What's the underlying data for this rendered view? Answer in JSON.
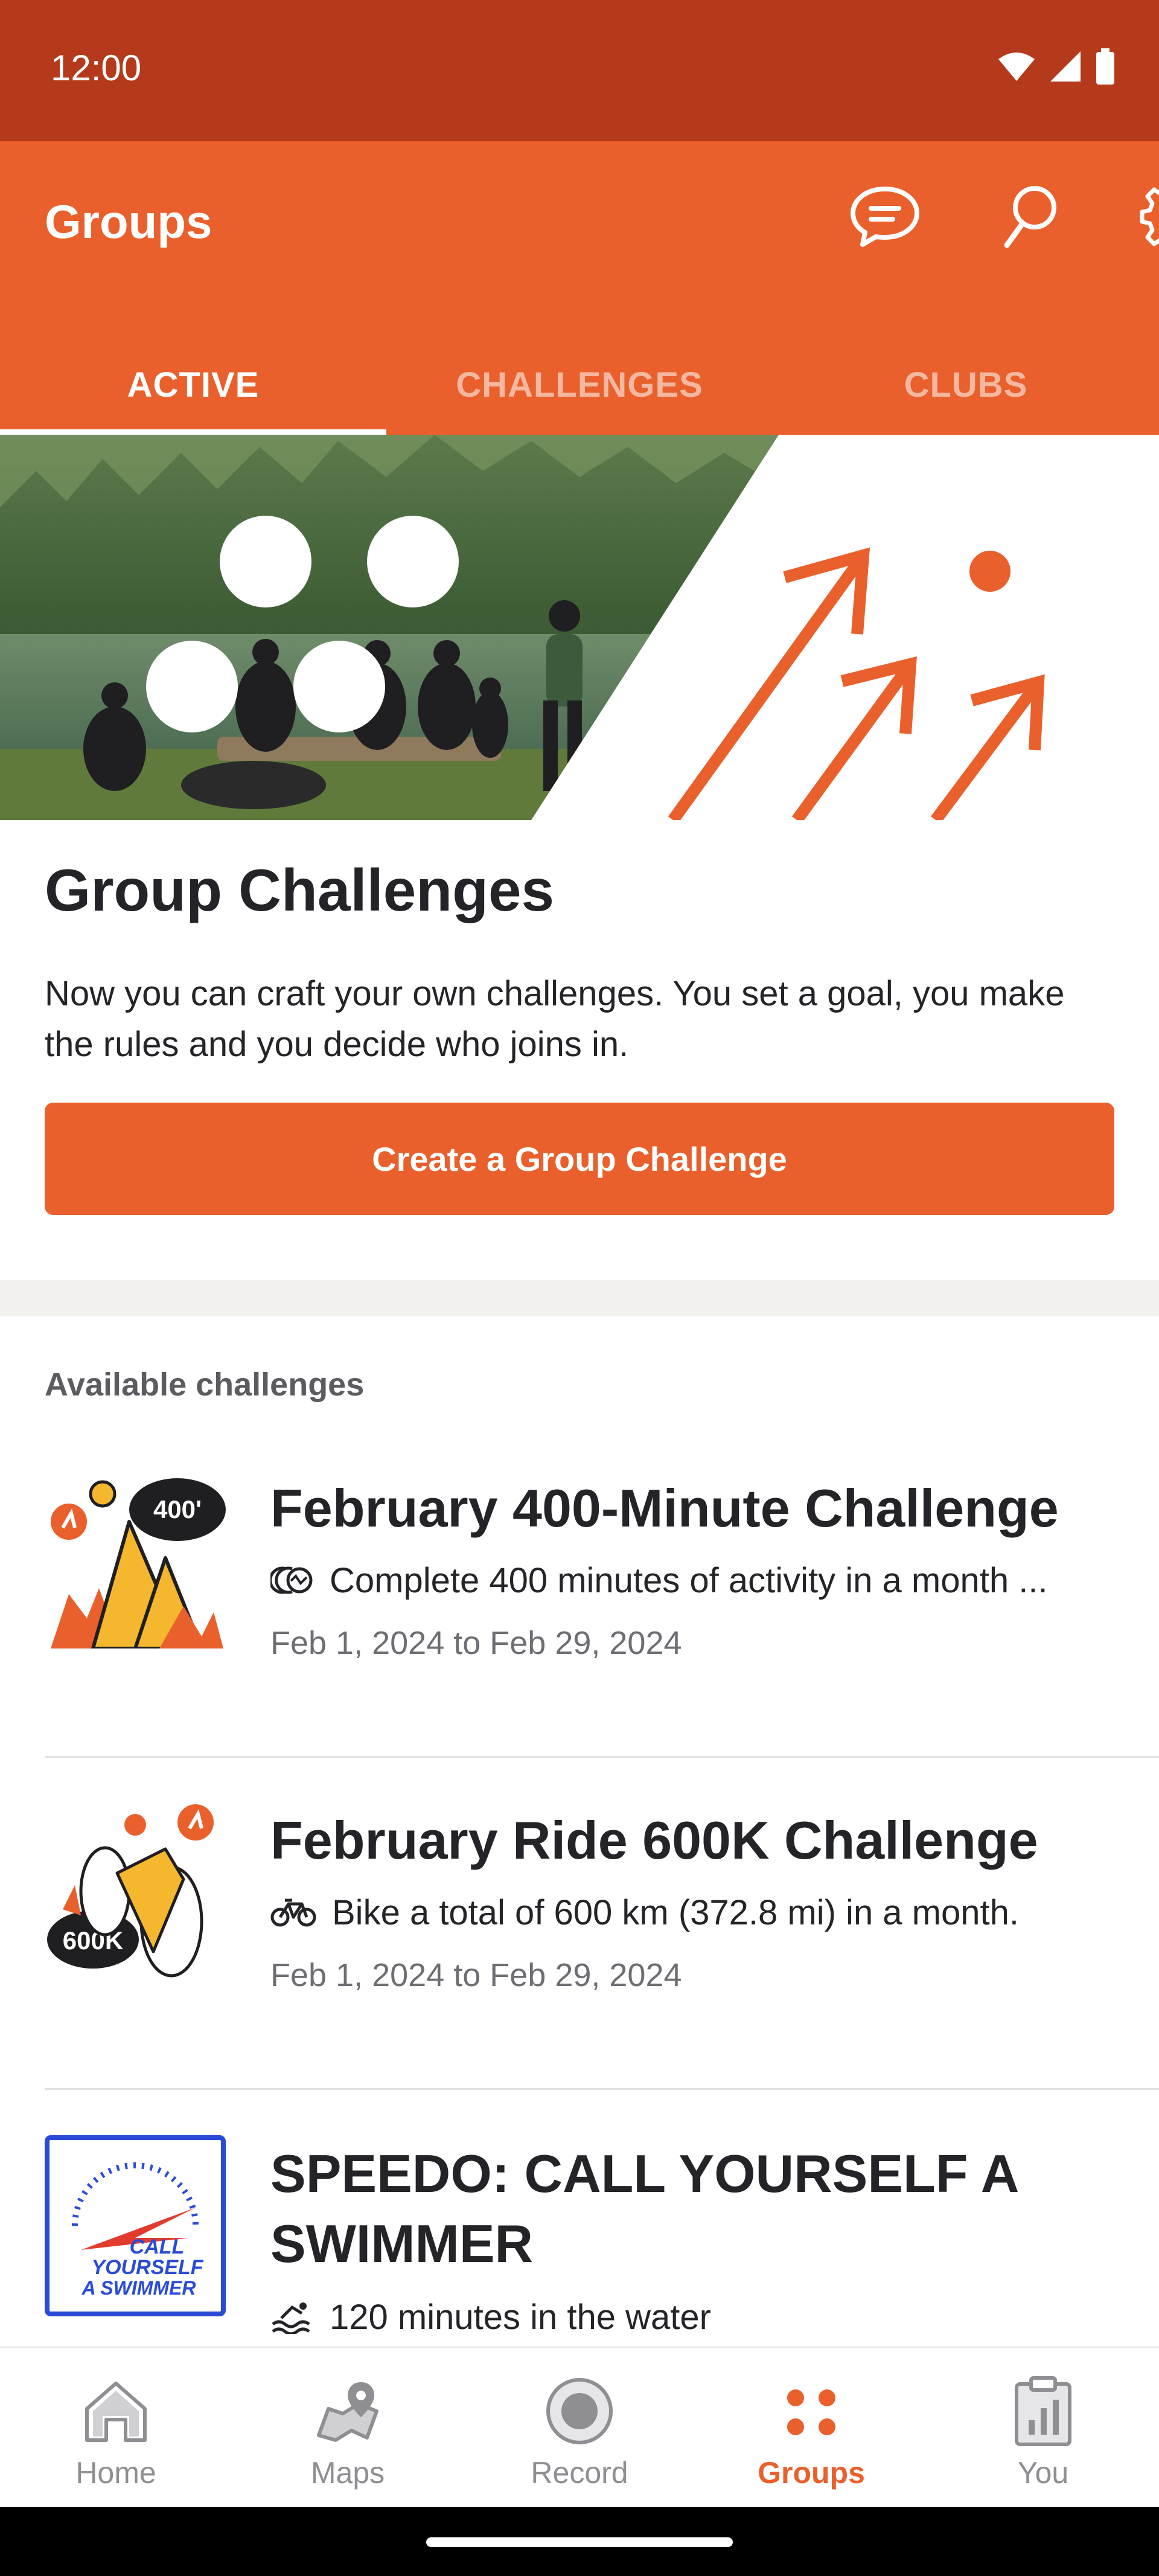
{
  "status_bar": {
    "time": "12:00"
  },
  "app_bar": {
    "title": "Groups",
    "tabs": [
      {
        "label": "ACTIVE",
        "active": true
      },
      {
        "label": "CHALLENGES",
        "active": false
      },
      {
        "label": "CLUBS",
        "active": false
      }
    ],
    "actions": [
      "chat-icon",
      "search-icon",
      "gear-icon"
    ]
  },
  "hero": {
    "title": "Group Challenges",
    "description": "Now you can craft your own challenges. You set a goal, you make the rules and you decide who joins in.",
    "button_label": "Create a Group Challenge"
  },
  "challenges": {
    "section_label": "Available challenges",
    "items": [
      {
        "name": "February 400-Minute Challenge",
        "detail": "Complete 400 minutes of activity in a month ...",
        "detail_icon": "activity-icon",
        "dates": "Feb 1, 2024 to Feb 29, 2024",
        "badge_text": "400'"
      },
      {
        "name": "February Ride 600K Challenge",
        "detail": "Bike a total of 600 km (372.8 mi) in a month.",
        "detail_icon": "bike-icon",
        "dates": "Feb 1, 2024 to Feb 29, 2024",
        "badge_text": "600K"
      },
      {
        "name": "SPEEDO: CALL YOURSELF A SWIMMER",
        "detail": "120 minutes in the water",
        "detail_icon": "swim-icon",
        "badge_lines": [
          "CALL",
          "YOURSELF",
          "A SWIMMER"
        ]
      }
    ]
  },
  "bottom_nav": {
    "items": [
      {
        "label": "Home",
        "icon": "home-icon",
        "active": false
      },
      {
        "label": "Maps",
        "icon": "maps-icon",
        "active": false
      },
      {
        "label": "Record",
        "icon": "record-icon",
        "active": false
      },
      {
        "label": "Groups",
        "icon": "groups-icon",
        "active": true
      },
      {
        "label": "You",
        "icon": "you-icon",
        "active": false
      }
    ]
  },
  "colors": {
    "brand": "#e9602c",
    "status_bar": "#b53a1c",
    "text": "#242428",
    "muted": "#6d6d73"
  }
}
